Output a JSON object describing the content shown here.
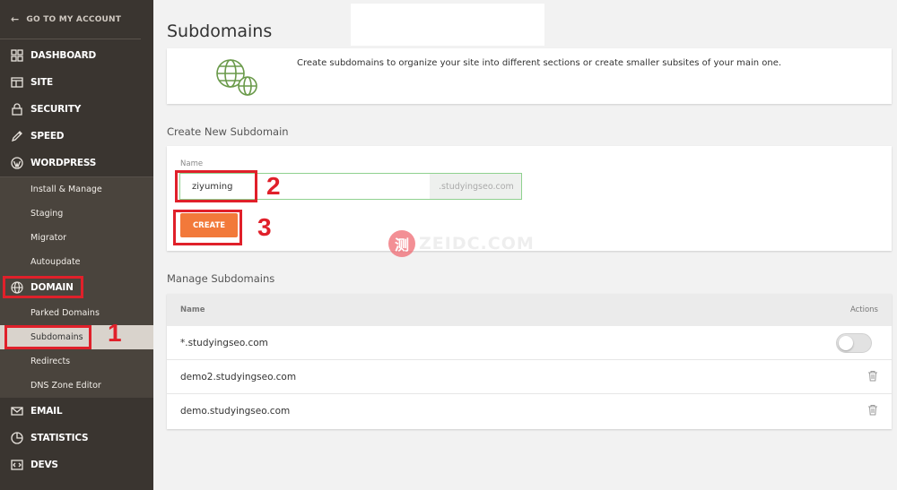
{
  "sidebar": {
    "back_label": "GO TO MY ACCOUNT",
    "items": [
      {
        "label": "DASHBOARD",
        "icon": "grid-icon"
      },
      {
        "label": "SITE",
        "icon": "site-icon"
      },
      {
        "label": "SECURITY",
        "icon": "lock-icon"
      },
      {
        "label": "SPEED",
        "icon": "rocket-icon"
      },
      {
        "label": "WORDPRESS",
        "icon": "wordpress-icon"
      }
    ],
    "wordpress_sub": [
      "Install & Manage",
      "Staging",
      "Migrator",
      "Autoupdate"
    ],
    "domain_label": "DOMAIN",
    "domain_sub": [
      "Parked Domains",
      "Subdomains",
      "Redirects",
      "DNS Zone Editor"
    ],
    "bottom_items": [
      {
        "label": "EMAIL",
        "icon": "mail-icon"
      },
      {
        "label": "STATISTICS",
        "icon": "pie-chart-icon"
      },
      {
        "label": "DEVS",
        "icon": "code-icon"
      }
    ]
  },
  "main": {
    "title": "Subdomains",
    "info_text": "Create subdomains to organize your site into different sections or create smaller subsites of your main one.",
    "create_section_label": "Create New Subdomain",
    "name_label": "Name",
    "name_value": "ziyuming",
    "domain_suffix": ".studyingseo.com",
    "create_button": "CREATE",
    "manage_section_label": "Manage Subdomains",
    "table": {
      "col_name": "Name",
      "col_actions": "Actions",
      "rows": [
        "*.studyingseo.com",
        "demo2.studyingseo.com",
        "demo.studyingseo.com"
      ]
    }
  },
  "annotations": [
    "1",
    "2",
    "3"
  ],
  "watermark": {
    "glyph": "测",
    "text": "ZEIDC.COM"
  },
  "colors": {
    "accent": "#f2793a",
    "sidebar": "#3a3530",
    "highlight": "#e0202a"
  }
}
